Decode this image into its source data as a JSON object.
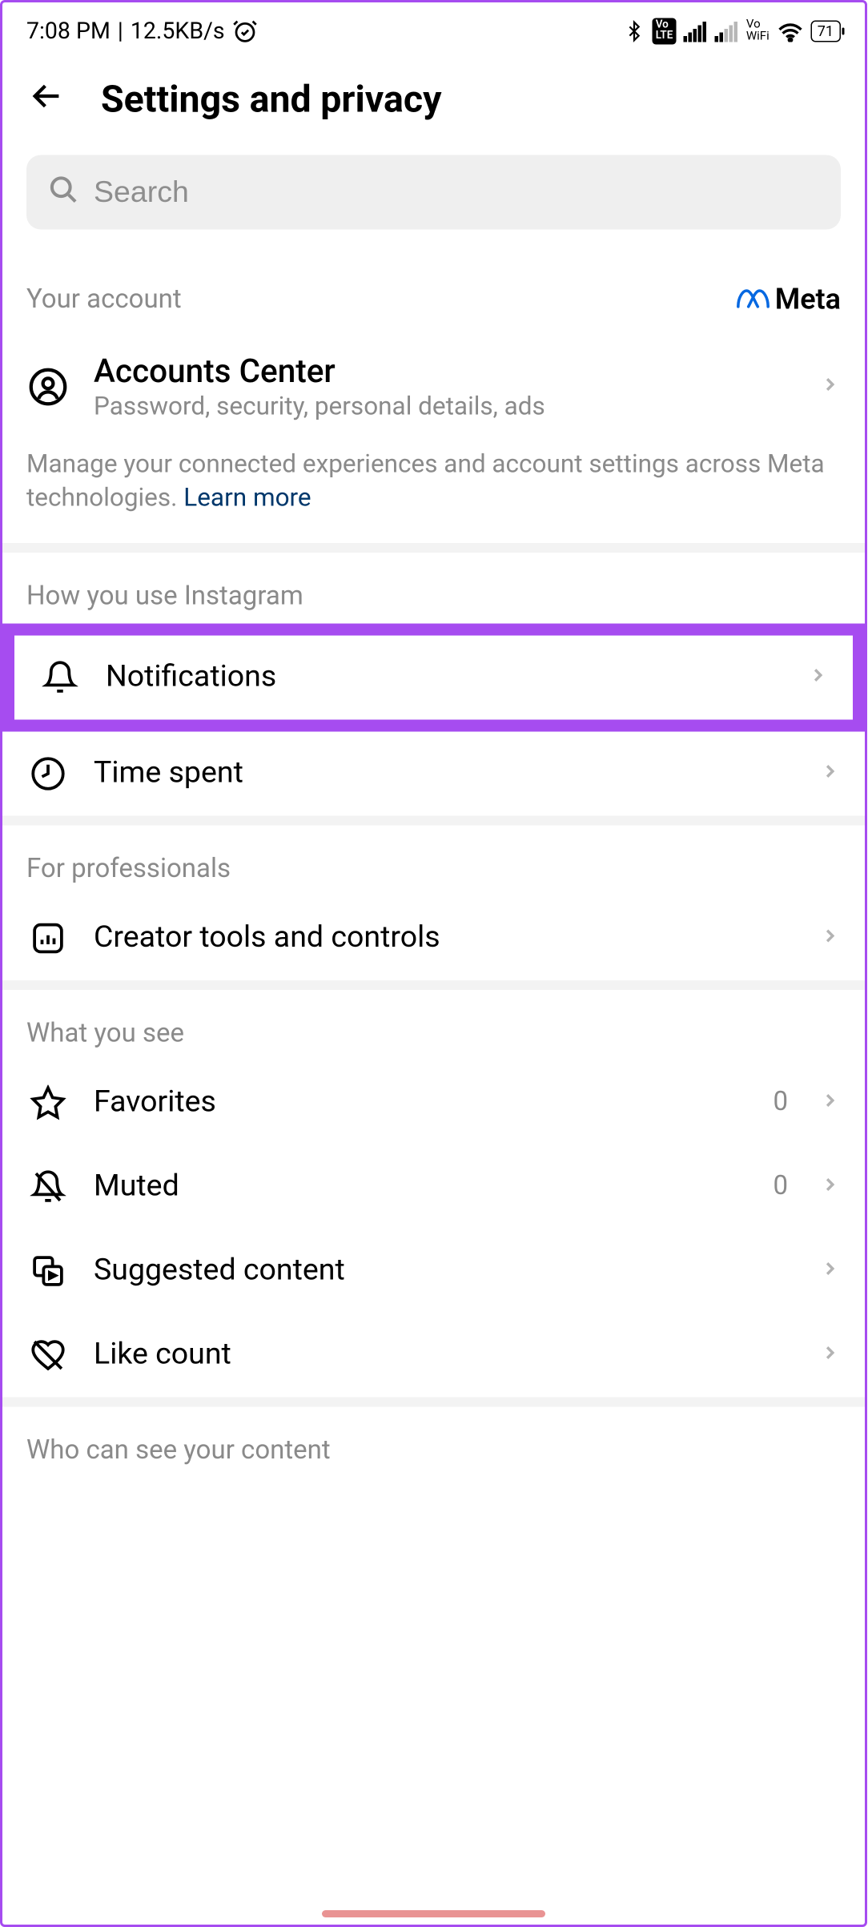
{
  "statusbar": {
    "time": "7:08 PM",
    "speed": "12.5KB/s",
    "vo_lte": "Vo LTE",
    "vo_wifi_top": "Vo",
    "vo_wifi_bottom": "WiFi",
    "battery": "71"
  },
  "header": {
    "title": "Settings and privacy"
  },
  "search": {
    "placeholder": "Search"
  },
  "account_section": {
    "label": "Your account",
    "meta_label": "Meta",
    "accounts_title": "Accounts Center",
    "accounts_sub": "Password, security, personal details, ads",
    "footnote_text": "Manage your connected experiences and account settings across Meta technologies. ",
    "learn_more": "Learn more"
  },
  "usage_section": {
    "label": "How you use Instagram",
    "notifications": "Notifications",
    "time_spent": "Time spent"
  },
  "pro_section": {
    "label": "For professionals",
    "creator": "Creator tools and controls"
  },
  "see_section": {
    "label": "What you see",
    "favorites": "Favorites",
    "favorites_count": "0",
    "muted": "Muted",
    "muted_count": "0",
    "suggested": "Suggested content",
    "like_count": "Like count"
  },
  "who_section": {
    "label": "Who can see your content"
  }
}
